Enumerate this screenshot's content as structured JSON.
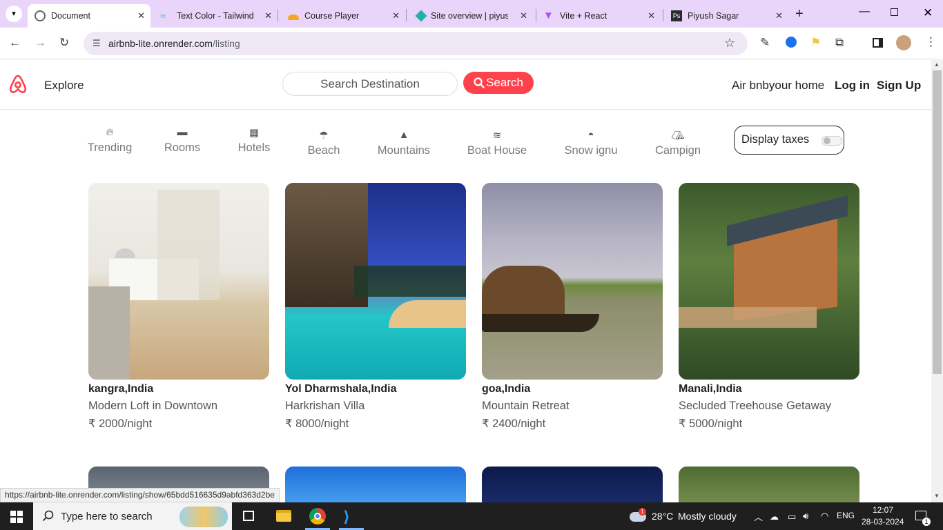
{
  "browser": {
    "tabs": [
      {
        "title": "Document",
        "active": true
      },
      {
        "title": "Text Color - Tailwind C"
      },
      {
        "title": "Course Player"
      },
      {
        "title": "Site overview | piyush"
      },
      {
        "title": "Vite + React"
      },
      {
        "title": "Piyush Sagar"
      }
    ],
    "url_host": "airbnb-lite.onrender.com",
    "url_path": "/listing",
    "status_url": "https://airbnb-lite.onrender.com/listing/show/65bdd516635d9abfd363d2be"
  },
  "navbar": {
    "explore": "Explore",
    "search_placeholder": "Search Destination",
    "search_button": "Search",
    "host_link": "Air bnbyour home",
    "login": "Log in",
    "signup": "Sign Up",
    "brand_color": "#fe424d"
  },
  "filters": [
    {
      "label": "Trending",
      "icon": "fire-icon"
    },
    {
      "label": "Rooms",
      "icon": "bed-icon"
    },
    {
      "label": "Hotels",
      "icon": "hotel-icon"
    },
    {
      "label": "Beach",
      "icon": "umbrella-beach-icon"
    },
    {
      "label": "Mountains",
      "icon": "mountain-icon"
    },
    {
      "label": "Boat House",
      "icon": "water-icon"
    },
    {
      "label": "Snow ignu",
      "icon": "igloo-icon"
    },
    {
      "label": "Campign",
      "icon": "campground-icon"
    }
  ],
  "tax_toggle": {
    "label": "Display taxes",
    "on": false
  },
  "listings": [
    {
      "location": "kangra,India",
      "title": "Modern Loft in Downtown",
      "price": "₹ 2000/night"
    },
    {
      "location": "Yol Dharmshala,India",
      "title": "Harkrishan Villa",
      "price": "₹ 8000/night"
    },
    {
      "location": "goa,India",
      "title": "Mountain Retreat",
      "price": "₹ 2400/night"
    },
    {
      "location": "Manali,India",
      "title": "Secluded Treehouse Getaway",
      "price": "₹ 5000/night"
    }
  ],
  "taskbar": {
    "search_placeholder": "Type here to search",
    "weather_temp": "28°C",
    "weather_desc": "Mostly cloudy",
    "weather_badge": "1",
    "language": "ENG",
    "time": "12:07",
    "date": "28-03-2024",
    "notification_count": "1"
  }
}
